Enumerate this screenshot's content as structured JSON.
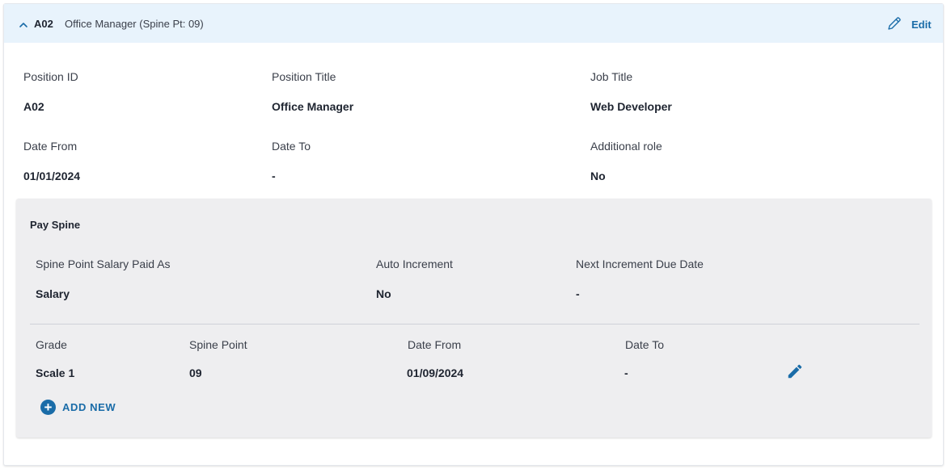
{
  "header": {
    "position_id": "A02",
    "title": "Office Manager (Spine Pt: 09)",
    "edit_label": "Edit"
  },
  "fields": {
    "position_id": {
      "label": "Position ID",
      "value": "A02"
    },
    "position_title": {
      "label": "Position Title",
      "value": "Office Manager"
    },
    "job_title": {
      "label": "Job Title",
      "value": "Web Developer"
    },
    "date_from": {
      "label": "Date From",
      "value": "01/01/2024"
    },
    "date_to": {
      "label": "Date To",
      "value": "-"
    },
    "additional_role": {
      "label": "Additional role",
      "value": "No"
    }
  },
  "pay_spine": {
    "title": "Pay Spine",
    "salary_paid_as": {
      "label": "Spine Point Salary Paid As",
      "value": "Salary"
    },
    "auto_increment": {
      "label": "Auto Increment",
      "value": "No"
    },
    "next_increment": {
      "label": "Next Increment Due Date",
      "value": "-"
    },
    "columns": [
      "Grade",
      "Spine Point",
      "Date From",
      "Date To"
    ],
    "rows": [
      {
        "grade": "Scale 1",
        "spine_point": "09",
        "date_from": "01/09/2024",
        "date_to": "-"
      }
    ],
    "add_new_label": "ADD NEW"
  },
  "colors": {
    "header_bg": "#e8f3fc",
    "accent": "#1a6ca8",
    "panel_bg": "#eeeef0"
  },
  "icons": [
    "chevron-up-icon",
    "pencil-outline-icon",
    "pencil-icon",
    "plus-circle-icon"
  ]
}
